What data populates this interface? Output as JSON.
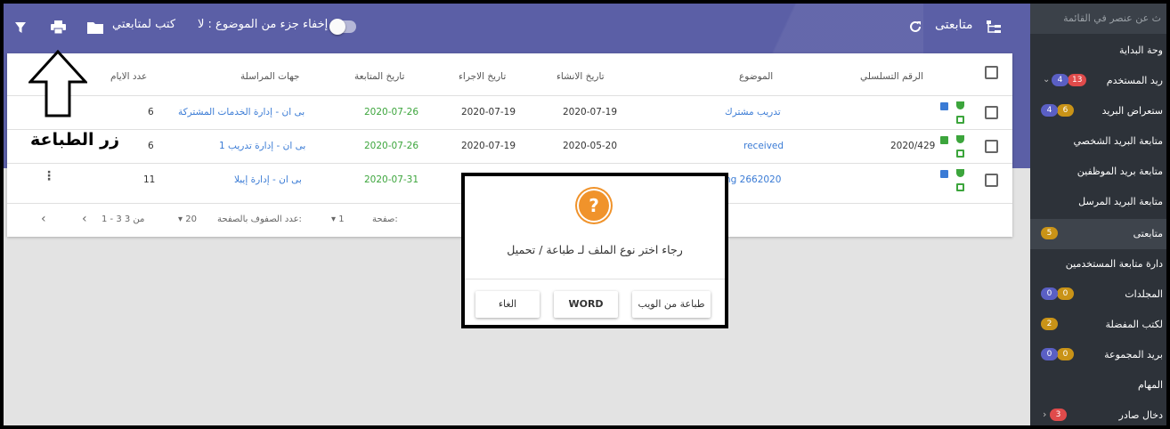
{
  "topbar": {
    "title": "متابعتى",
    "toggle_label": "إخفاء جزء من الموضوع : لا",
    "folder_label": "كتب لمتابعتي"
  },
  "table": {
    "headers": {
      "serial": "الرقم التسلسلي",
      "subject": "الموضوع",
      "created": "تاريخ الانشاء",
      "action": "تاريخ الاجراء",
      "followup": "تاريخ المتابعة",
      "parties": "جهات المراسلة",
      "days": "عدد الايام"
    },
    "rows": [
      {
        "serial": "",
        "subject": "تدريب مشترك",
        "created": "2020-07-19",
        "action": "2020-07-19",
        "followup": "2020-07-26",
        "parties": "بى ان - إدارة الخدمات المشتركة",
        "days": "6"
      },
      {
        "serial": "2020/429",
        "subject": "received",
        "created": "2020-05-20",
        "action": "2020-07-19",
        "followup": "2020-07-26",
        "parties": "بى ان - إدارة تدريب 1",
        "days": "6"
      },
      {
        "serial": "",
        "subject": "ng 2662020",
        "created": "",
        "action": "",
        "followup": "2020-07-31",
        "parties": "بى ان - إدارة إيبلا",
        "days": "11"
      }
    ],
    "footer": {
      "page_label": "صفحة:",
      "page_value": "1",
      "rows_label": "عدد الصفوف بالصفحة:",
      "rows_value": "20",
      "range": "1 - 3 من 3"
    }
  },
  "annotation": {
    "label": "زر الطباعة"
  },
  "dialog": {
    "icon": "?",
    "message": "رجاء اختر نوع الملف لـ طباعة / تحميل",
    "btn_web": "طباعة من الويب",
    "btn_word": "WORD",
    "btn_cancel": "الغاء"
  },
  "sidebar": {
    "search_placeholder": "ث عن عنصر في القائمة",
    "items": [
      {
        "label": "وحة البداية",
        "badges": []
      },
      {
        "label": "ريد المستخدم",
        "badges": [
          "13",
          "4"
        ]
      },
      {
        "label": "ستعراض البريد",
        "badges": [
          "6",
          "4"
        ]
      },
      {
        "label": "متابعة البريد الشخصي",
        "badges": []
      },
      {
        "label": "متابعة بريد الموظفين",
        "badges": []
      },
      {
        "label": "متابعة البريد المرسل",
        "badges": []
      },
      {
        "label": "متابعتى",
        "badges": [
          "5"
        ]
      },
      {
        "label": "دارة متابعة المستخدمين",
        "badges": []
      },
      {
        "label": "المجلدات",
        "badges": [
          "0",
          "0"
        ]
      },
      {
        "label": "لكتب المفضلة",
        "badges": [
          "2"
        ]
      },
      {
        "label": "بريد المجموعة",
        "badges": [
          "0",
          "0"
        ]
      },
      {
        "label": "المهام",
        "badges": []
      },
      {
        "label": "دخال صادر",
        "badges": [
          "3"
        ]
      }
    ]
  },
  "colors": {
    "header": "#5b5fa6",
    "sidebar": "#2d3239",
    "link": "#3a7bd5",
    "followup": "#3ca53c",
    "question_icon": "#f0932b"
  }
}
